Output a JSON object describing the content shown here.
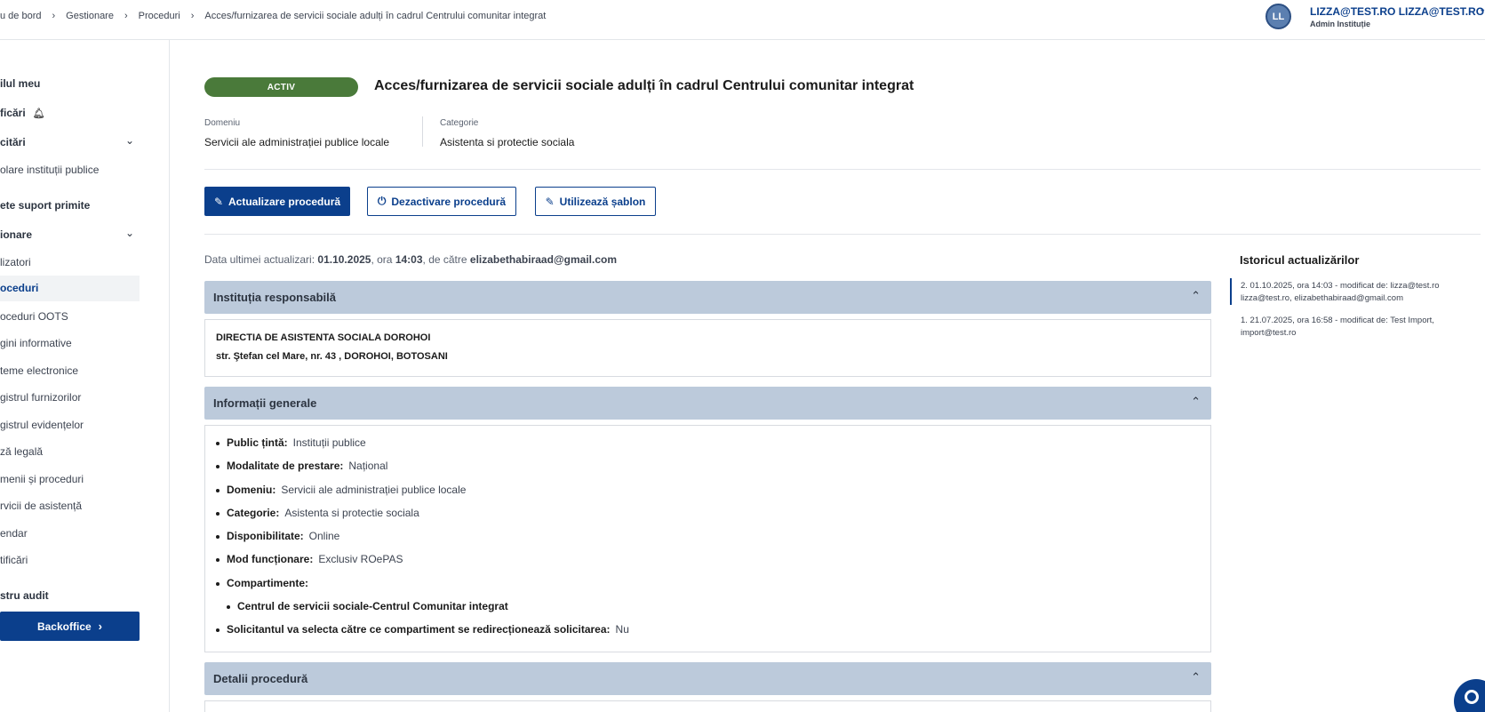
{
  "breadcrumb": {
    "items": [
      "u de bord",
      "Gestionare",
      "Proceduri",
      "Acces/furnizarea de servicii sociale adulți în cadrul Centrului comunitar integrat"
    ],
    "separator": "›"
  },
  "user": {
    "initials": "LL",
    "name": "LIZZA@TEST.RO LIZZA@TEST.RO",
    "role": "Admin Instituție",
    "chevron": "⌄"
  },
  "sidebar": {
    "items": [
      {
        "label": "ilul meu",
        "style": "bold"
      },
      {
        "label": "ficări",
        "style": "bold"
      },
      {
        "label": "citări",
        "style": "bold"
      },
      {
        "label": "olare instituții publice",
        "style": "normal"
      },
      {
        "label": "ete suport primite",
        "style": "bold"
      },
      {
        "label": "ionare",
        "style": "bold"
      },
      {
        "label": "lizatori",
        "style": "normal"
      },
      {
        "label": "oceduri",
        "style": "active"
      },
      {
        "label": "oceduri OOTS",
        "style": "normal"
      },
      {
        "label": "gini informative",
        "style": "normal"
      },
      {
        "label": "teme electronice",
        "style": "normal"
      },
      {
        "label": "gistrul furnizorilor",
        "style": "normal"
      },
      {
        "label": "gistrul evidențelor",
        "style": "normal"
      },
      {
        "label": "ză legală",
        "style": "normal"
      },
      {
        "label": "menii și proceduri",
        "style": "normal"
      },
      {
        "label": "rvicii de asistență",
        "style": "normal"
      },
      {
        "label": "endar",
        "style": "normal"
      },
      {
        "label": "tificări",
        "style": "normal"
      },
      {
        "label": "stru audit",
        "style": "bold"
      }
    ],
    "backoffice_label": "Backoffice",
    "backoffice_arrow": "›"
  },
  "main": {
    "status": "ACTIV",
    "title": "Acces/furnizarea de servicii sociale adulți în cadrul Centrului comunitar integrat",
    "domain_label": "Domeniu",
    "domain_value": "Servicii ale administrației publice locale",
    "category_label": "Categorie",
    "category_value": "Asistenta si protectie sociala",
    "buttons": {
      "update": "Actualizare procedură",
      "deactivate": "Dezactivare procedură",
      "template": "Utilizează șablon"
    },
    "last_update": {
      "prefix": "Data ultimei actualizari:",
      "date": "01.10.2025",
      "mid": ", ora",
      "time": "14:03",
      "by": ", de către",
      "email": "elizabethabiraad@gmail.com"
    },
    "sections": {
      "institution": {
        "title": "Instituția responsabilă",
        "name": "DIRECTIA DE ASISTENTA SOCIALA DOROHOI",
        "address": "str. Ştefan cel Mare, nr. 43 , DOROHOI, BOTOSANI"
      },
      "general": {
        "title": "Informații generale",
        "items": [
          {
            "key": "Public țintă:",
            "value": "Instituții publice"
          },
          {
            "key": "Modalitate de prestare:",
            "value": "Național"
          },
          {
            "key": "Domeniu:",
            "value": "Servicii ale administrației publice locale"
          },
          {
            "key": "Categorie:",
            "value": "Asistenta si protectie sociala"
          },
          {
            "key": "Disponibilitate:",
            "value": "Online"
          },
          {
            "key": "Mod funcționare:",
            "value": "Exclusiv ROePAS"
          },
          {
            "key": "Compartimente:",
            "value": ""
          },
          {
            "key": "Centrul de servicii sociale-Centrul Comunitar integrat",
            "value": "",
            "sub": true
          },
          {
            "key": "Solicitantul va selecta către ce compartiment se redirecționează solicitarea:",
            "value": "Nu"
          }
        ]
      },
      "details": {
        "title": "Detalii procedură"
      }
    }
  },
  "history": {
    "title": "Istoricul actualizărilor",
    "entries": [
      "2. 01.10.2025, ora 14:03 - modificat de: lizza@test.ro lizza@test.ro, elizabethabiraad@gmail.com",
      "1. 21.07.2025, ora 16:58 - modificat de: Test Import, import@test.ro"
    ]
  },
  "colors": {
    "primary": "#0b3f8c",
    "active_badge": "#4a7a3a",
    "accordion_header": "#bccadb"
  }
}
